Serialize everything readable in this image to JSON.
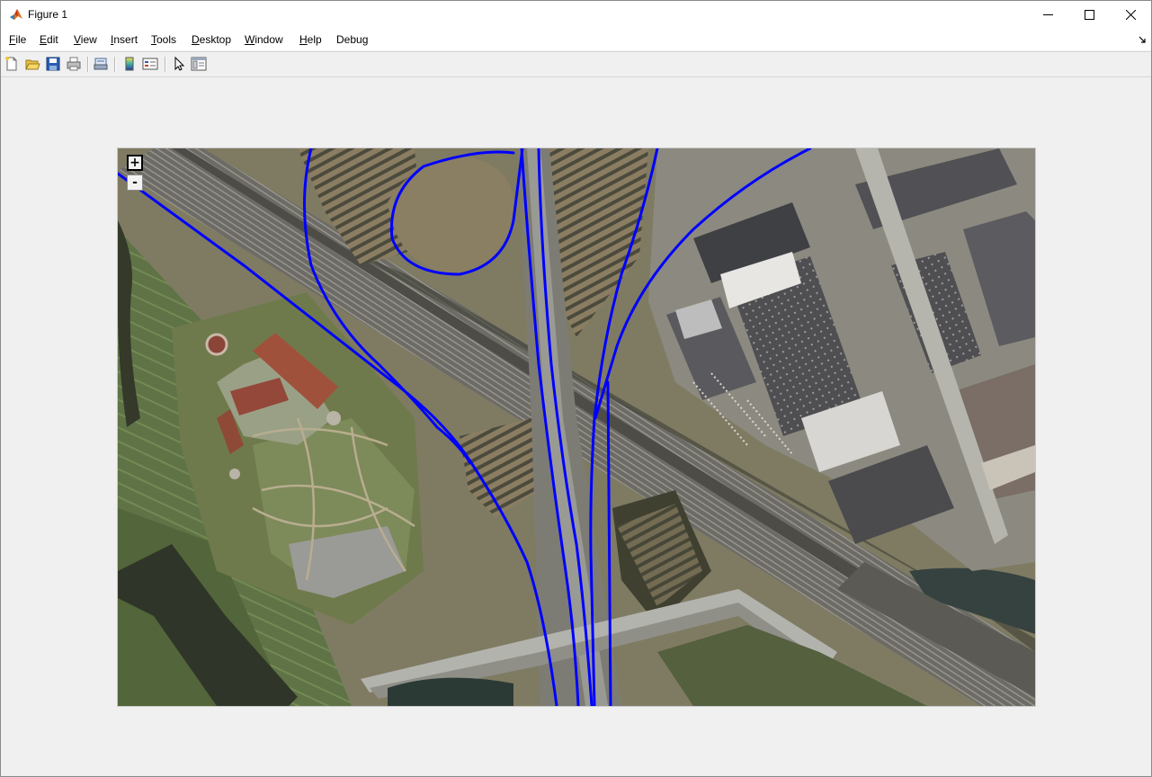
{
  "window": {
    "title": "Figure 1",
    "icon": "matlab-icon",
    "controls": [
      "minimize-icon",
      "maximize-icon",
      "close-icon"
    ]
  },
  "menu": {
    "items": [
      {
        "label": "File",
        "u": "F",
        "rest": "ile"
      },
      {
        "label": "Edit",
        "u": "E",
        "rest": "dit"
      },
      {
        "label": "View",
        "u": "V",
        "rest": "iew"
      },
      {
        "label": "Insert",
        "u": "I",
        "rest": "nsert"
      },
      {
        "label": "Tools",
        "u": "T",
        "rest": "ools"
      },
      {
        "label": "Desktop",
        "u": "D",
        "rest": "esktop"
      },
      {
        "label": "Window",
        "u": "W",
        "rest": "indow"
      },
      {
        "label": "Help",
        "u": "H",
        "rest": "elp"
      },
      {
        "label": "Debug",
        "u": "",
        "rest": "Debug"
      }
    ]
  },
  "toolbar": {
    "buttons": [
      "new-figure-icon",
      "open-file-icon",
      "save-icon",
      "print-icon",
      "link-plot-icon",
      "colorbar-icon",
      "legend-icon",
      "pointer-icon",
      "property-inspector-icon"
    ]
  },
  "map": {
    "zoom_in_label": "+",
    "zoom_out_label": "-",
    "route_color": "#0000ff"
  }
}
